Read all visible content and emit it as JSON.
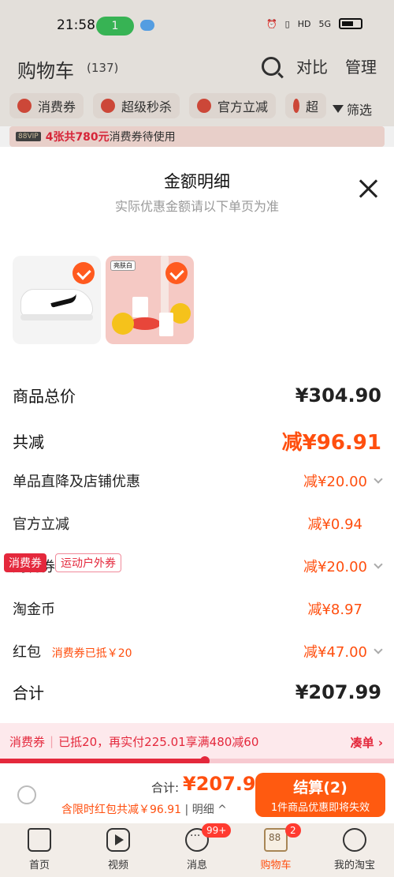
{
  "status": {
    "time": "21:58",
    "wifi_count": "1",
    "right_icons": [
      "alarm-icon",
      "vibrate-icon",
      "hd-icon",
      "5g-icon",
      "battery-icon"
    ]
  },
  "header": {
    "title": "购物车",
    "count": "(137)",
    "compare": "对比",
    "manage": "管理"
  },
  "chips": [
    {
      "label": "消费券"
    },
    {
      "label": "超级秒杀"
    },
    {
      "label": "官方立减"
    },
    {
      "label": "超"
    }
  ],
  "filter_label": "筛选",
  "vip_bar": {
    "badge": "88VIP",
    "highlight": "4张共780元",
    "text": "消费券待使用"
  },
  "sheet": {
    "title": "金额明细",
    "subtitle": "实际优惠金额请以下单页为准",
    "products": [
      {
        "name": "white-sneaker",
        "checked": true
      },
      {
        "name": "lemon-whitening-product",
        "tag": "亮肤白",
        "checked": true
      }
    ],
    "rows": [
      {
        "label": "商品总价",
        "value": "¥304.90"
      },
      {
        "label": "共减",
        "value": "减¥96.91"
      },
      {
        "label": "单品直降及店铺优惠",
        "value": "减¥20.00"
      },
      {
        "label": "官方立减",
        "value": "减¥0.94"
      },
      {
        "label": "购物券",
        "value": "减¥20.00"
      },
      {
        "label": "淘金币",
        "value": "减¥8.97"
      },
      {
        "label": "红包",
        "sub": "消费券已抵￥20",
        "value": "减¥47.00"
      },
      {
        "label": "合计",
        "value": "¥207.99"
      }
    ]
  },
  "coupon_tags": {
    "a": "消费券",
    "b": "运动户外券"
  },
  "promo": {
    "tag": "消费券",
    "text": "已抵20，再实付225.01享满480减60",
    "link": "凑单 ›",
    "progress": 0.52
  },
  "checkout": {
    "total_label": "合计:",
    "total_value": "¥207.99",
    "detail": "含限时红包共减￥96.91",
    "detail_link": "明细 ^",
    "pay_main": "结算(2)",
    "pay_sub": "1件商品优惠即将失效"
  },
  "tabbar": [
    {
      "label": "首页",
      "icon": "home-icon"
    },
    {
      "label": "视频",
      "icon": "video-icon"
    },
    {
      "label": "消息",
      "icon": "message-icon",
      "badge": "99+"
    },
    {
      "label": "购物车",
      "icon": "cart-icon",
      "badge": "2",
      "active": true
    },
    {
      "label": "我的淘宝",
      "icon": "profile-icon"
    }
  ],
  "colors": {
    "accent": "#ff4f0f",
    "brand_red": "#e4283c",
    "background": "#f2ede8"
  }
}
